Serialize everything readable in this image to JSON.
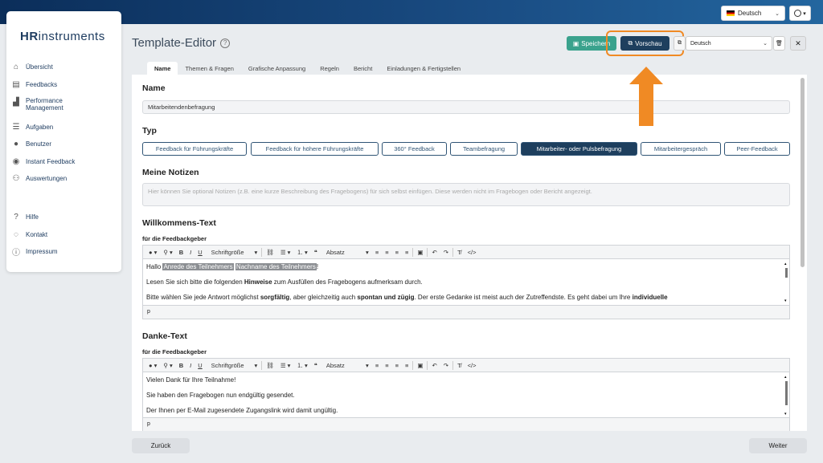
{
  "top": {
    "language": "Deutsch"
  },
  "sidebar": {
    "logo_a": "HR",
    "logo_b": "instruments",
    "items": [
      {
        "label": "Übersicht"
      },
      {
        "label": "Feedbacks"
      },
      {
        "label": "Performance"
      },
      {
        "label": "Management"
      },
      {
        "label": "Aufgaben"
      },
      {
        "label": "Benutzer"
      },
      {
        "label": "Instant Feedback"
      },
      {
        "label": "Auswertungen"
      }
    ],
    "footer": [
      {
        "label": "Hilfe"
      },
      {
        "label": "Kontakt"
      },
      {
        "label": "Impressum"
      }
    ]
  },
  "header": {
    "title": "Template-Editor",
    "save": "Speichern",
    "preview": "Vorschau",
    "language": "Deutsch"
  },
  "tabs": [
    "Name",
    "Themen & Fragen",
    "Grafische Anpassung",
    "Regeln",
    "Bericht",
    "Einladungen & Fertigstellen"
  ],
  "form": {
    "name_title": "Name",
    "name_value": "Mitarbeitendenbefragung",
    "type_title": "Typ",
    "types": [
      "Feedback für Führungskräfte",
      "Feedback für höhere Führungskräfte",
      "360° Feedback",
      "Teambefragung",
      "Mitarbeiter- oder Pulsbefragung",
      "Mitarbeitergespräch",
      "Peer-Feedback"
    ],
    "notes_title": "Meine Notizen",
    "notes_placeholder": "Hier können Sie optional Notizen (z.B. eine kurze Beschreibung des Fragebogens) für sich selbst einfügen. Diese werden nicht im Fragebogen oder Bericht angezeigt.",
    "welcome_title": "Willkommens-Text",
    "welcome_sub": "für die Feedbackgeber",
    "welcome_l1a": "Hallo ",
    "welcome_tag1": "Anrede des Teilnehmers",
    "welcome_tag2": "Nachname des Teilnehmers",
    "welcome_l1b": "!",
    "welcome_l2a": "Lesen Sie sich bitte die folgenden ",
    "welcome_l2b": "Hinweise",
    "welcome_l2c": " zum Ausfüllen des Fragebogens aufmerksam durch.",
    "welcome_l3a": "Bitte wählen Sie jede Antwort möglichst ",
    "welcome_l3b": "sorgfältig",
    "welcome_l3c": ", aber gleichzeitig auch ",
    "welcome_l3d": "spontan und zügig",
    "welcome_l3e": ". Der erste Gedanke ist meist auch der Zutreffendste. Es geht dabei um Ihre ",
    "welcome_l3f": "individuelle",
    "thanks_title": "Danke-Text",
    "thanks_sub": "für die Feedbackgeber",
    "thanks_l1": "Vielen Dank für Ihre Teilnahme!",
    "thanks_l2": "Sie haben den Fragebogen nun endgültig gesendet.",
    "thanks_l3": "Der Ihnen per E-Mail zugesendete Zugangslink wird damit ungültig.",
    "footer_p": "p"
  },
  "toolbar": {
    "fontsize": "Schriftgröße",
    "paragraph": "Absatz"
  },
  "buttons": {
    "back": "Zurück",
    "next": "Weiter"
  }
}
